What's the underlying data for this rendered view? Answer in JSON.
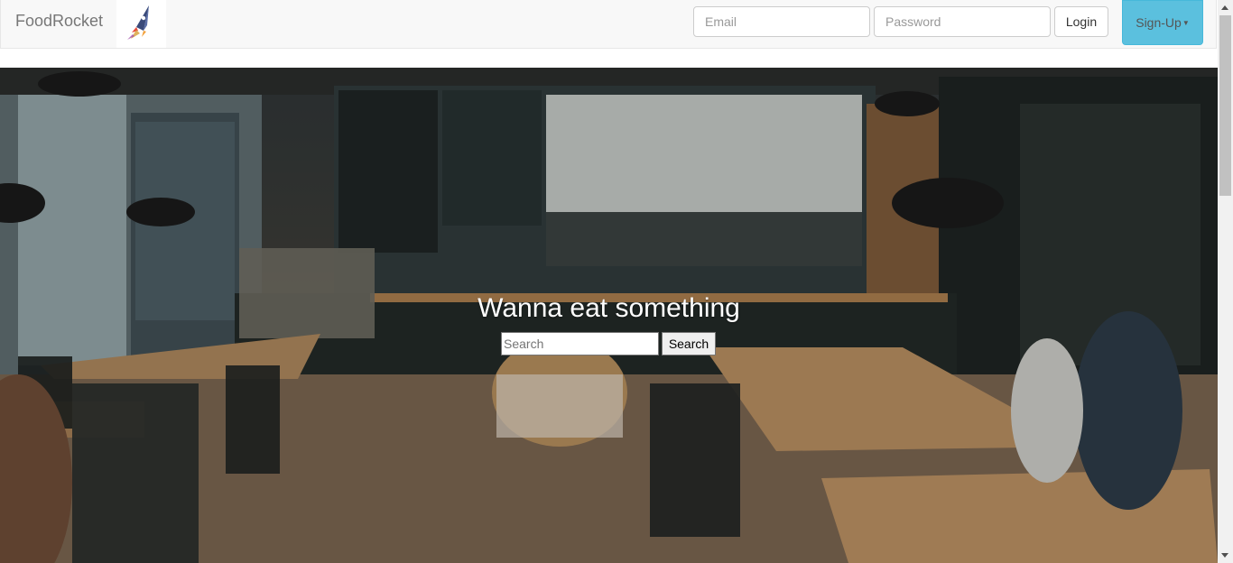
{
  "navbar": {
    "brand": "FoodRocket",
    "logo_icon": "rocket-icon",
    "email_placeholder": "Email",
    "password_placeholder": "Password",
    "login_label": "Login",
    "signup_label": "Sign-Up",
    "signup_color": "#5bc0de"
  },
  "hero": {
    "background": "cafe interior photo",
    "title": "Wanna eat something",
    "search_placeholder": "Search",
    "search_button": "Search"
  }
}
